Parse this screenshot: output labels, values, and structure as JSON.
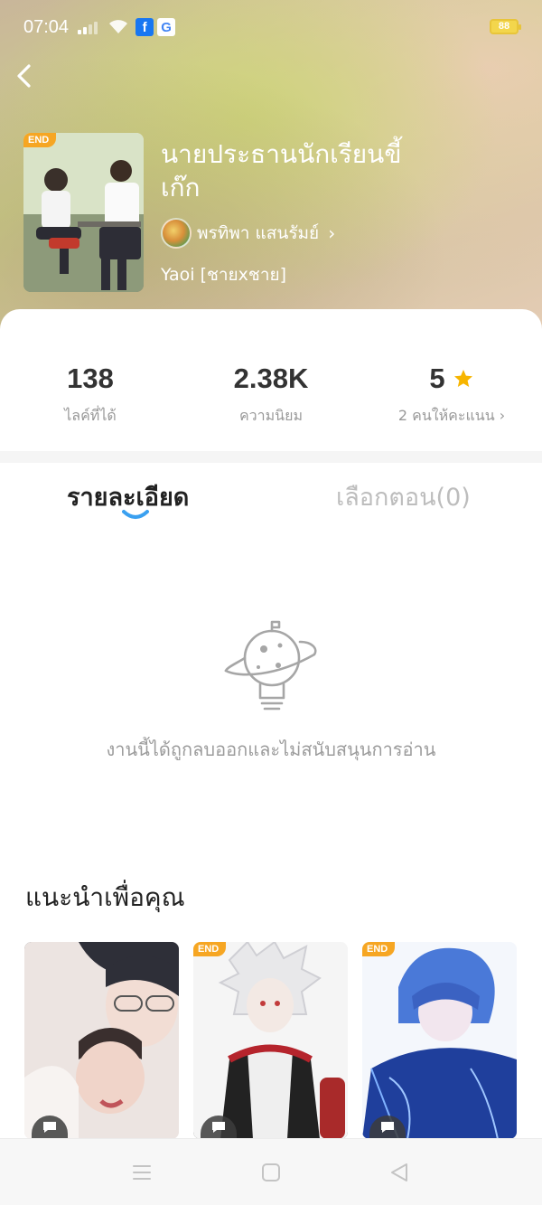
{
  "status_bar": {
    "time": "07:04",
    "battery": "88",
    "app_icons": [
      "facebook-icon",
      "google-icon"
    ],
    "fb_glyph": "f",
    "google_glyph": "G"
  },
  "book": {
    "title": "นายประธานนักเรียนขี้เก๊ก",
    "author": "พรทิพา แสนรัมย์",
    "genre": "Yaoi [ชายxชาย]",
    "status_badge": "END"
  },
  "stats": [
    {
      "value": "138",
      "label": "ไลค์ที่ได้"
    },
    {
      "value": "2.38K",
      "label": "ความนิยม"
    },
    {
      "value": "5",
      "label": "2 คนให้คะแนน ›"
    }
  ],
  "tabs": {
    "details": "รายละเอียด",
    "episodes": "เลือกตอน(0)"
  },
  "empty_message": "งานนี้ได้ถูกลบออกและไม่สนับสนุนการอ่าน",
  "recommend": {
    "title": "แนะนำเพื่อคุณ",
    "items": [
      {
        "badge": ""
      },
      {
        "badge": "END"
      },
      {
        "badge": "END"
      }
    ]
  },
  "colors": {
    "accent_blue": "#3aa0f0",
    "badge_orange": "#f6a623",
    "star_yellow": "#f7b500"
  }
}
